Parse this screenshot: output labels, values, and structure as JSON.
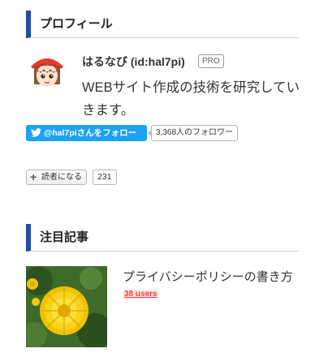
{
  "profile_section": {
    "heading": "プロフィール",
    "name": "はるなび (id:hal7pi)",
    "pro_badge": "PRO",
    "description": "WEBサイト作成の技術を研究していきます。",
    "twitter_follow_label": "@hal7piさんをフォロー",
    "follower_count_label": "3,368人のフォロワー",
    "reader_button_label": "読者になる",
    "reader_count": "231"
  },
  "featured_section": {
    "heading": "注目記事",
    "articles": [
      {
        "title": "プライバシーポリシーの書き方",
        "users_label": "38 users"
      }
    ]
  },
  "colors": {
    "accent": "#1f4ea1",
    "twitter_blue": "#1da1f2",
    "users_red": "#ff3d3d"
  },
  "icons": {
    "twitter": "twitter-bird-icon",
    "plus": "plus-icon"
  }
}
